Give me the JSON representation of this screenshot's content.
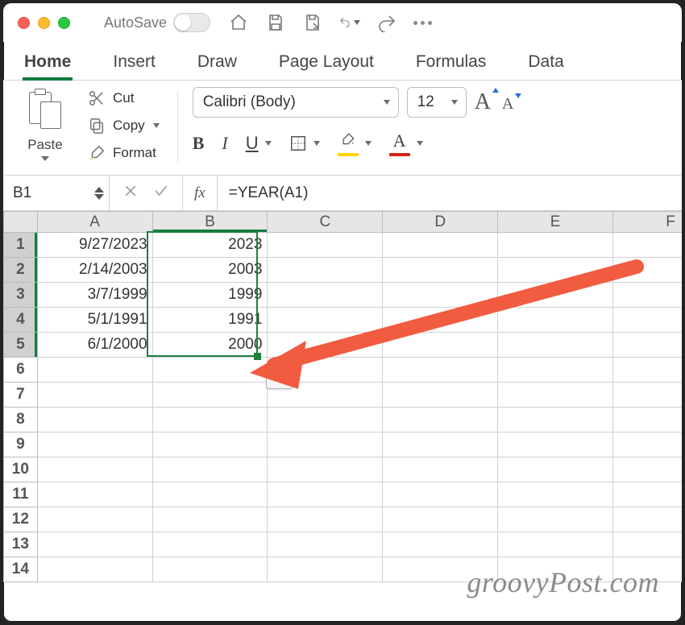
{
  "titlebar": {
    "autosave_label": "AutoSave"
  },
  "tabs": {
    "items": [
      "Home",
      "Insert",
      "Draw",
      "Page Layout",
      "Formulas",
      "Data"
    ],
    "active_index": 0
  },
  "ribbon": {
    "clipboard": {
      "paste": "Paste",
      "cut": "Cut",
      "copy": "Copy",
      "format": "Format"
    },
    "font": {
      "name": "Calibri (Body)",
      "size": "12",
      "bold": "B",
      "italic": "I",
      "underline": "U",
      "grow": "A",
      "shrink": "A",
      "font_color_letter": "A"
    }
  },
  "namebox": {
    "value": "B1"
  },
  "formula_bar": {
    "fx_label": "fx",
    "value": "=YEAR(A1)"
  },
  "grid": {
    "columns": [
      "A",
      "B",
      "C",
      "D",
      "E",
      "F"
    ],
    "row_count": 14,
    "selection": {
      "col": "B",
      "rows": [
        1,
        5
      ],
      "active_cell": "B1"
    },
    "cells": {
      "A": [
        "9/27/2023",
        "2/14/2003",
        "3/7/1999",
        "5/1/1991",
        "6/1/2000"
      ],
      "B": [
        "2023",
        "2003",
        "1999",
        "1991",
        "2000"
      ]
    }
  },
  "watermark": "groovyPost.com"
}
